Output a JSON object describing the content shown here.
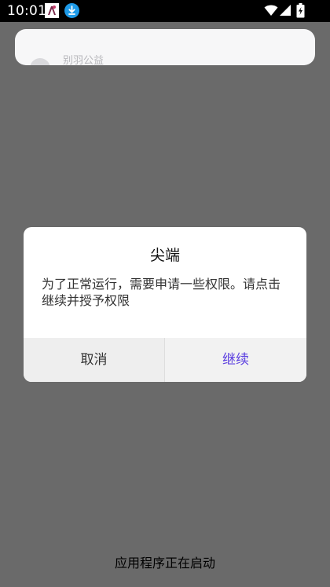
{
  "status_bar": {
    "time": "10:01",
    "icons": [
      "app-notification-icon",
      "download-icon",
      "wifi-icon",
      "signal-icon",
      "battery-icon"
    ]
  },
  "background_card": {
    "text": "别羽公益"
  },
  "dialog": {
    "title": "尖端",
    "message": "为了正常运行，需要申请一些权限。请点击继续并授予权限",
    "cancel_label": "取消",
    "continue_label": "继续"
  },
  "bottom_status": "应用程序正在启动",
  "colors": {
    "overlay": "#6a6a6a",
    "dialog_bg": "#ffffff",
    "button_bar_bg": "#eeeeee",
    "accent": "#5b3fe0",
    "status_bar_bg": "#000000"
  }
}
